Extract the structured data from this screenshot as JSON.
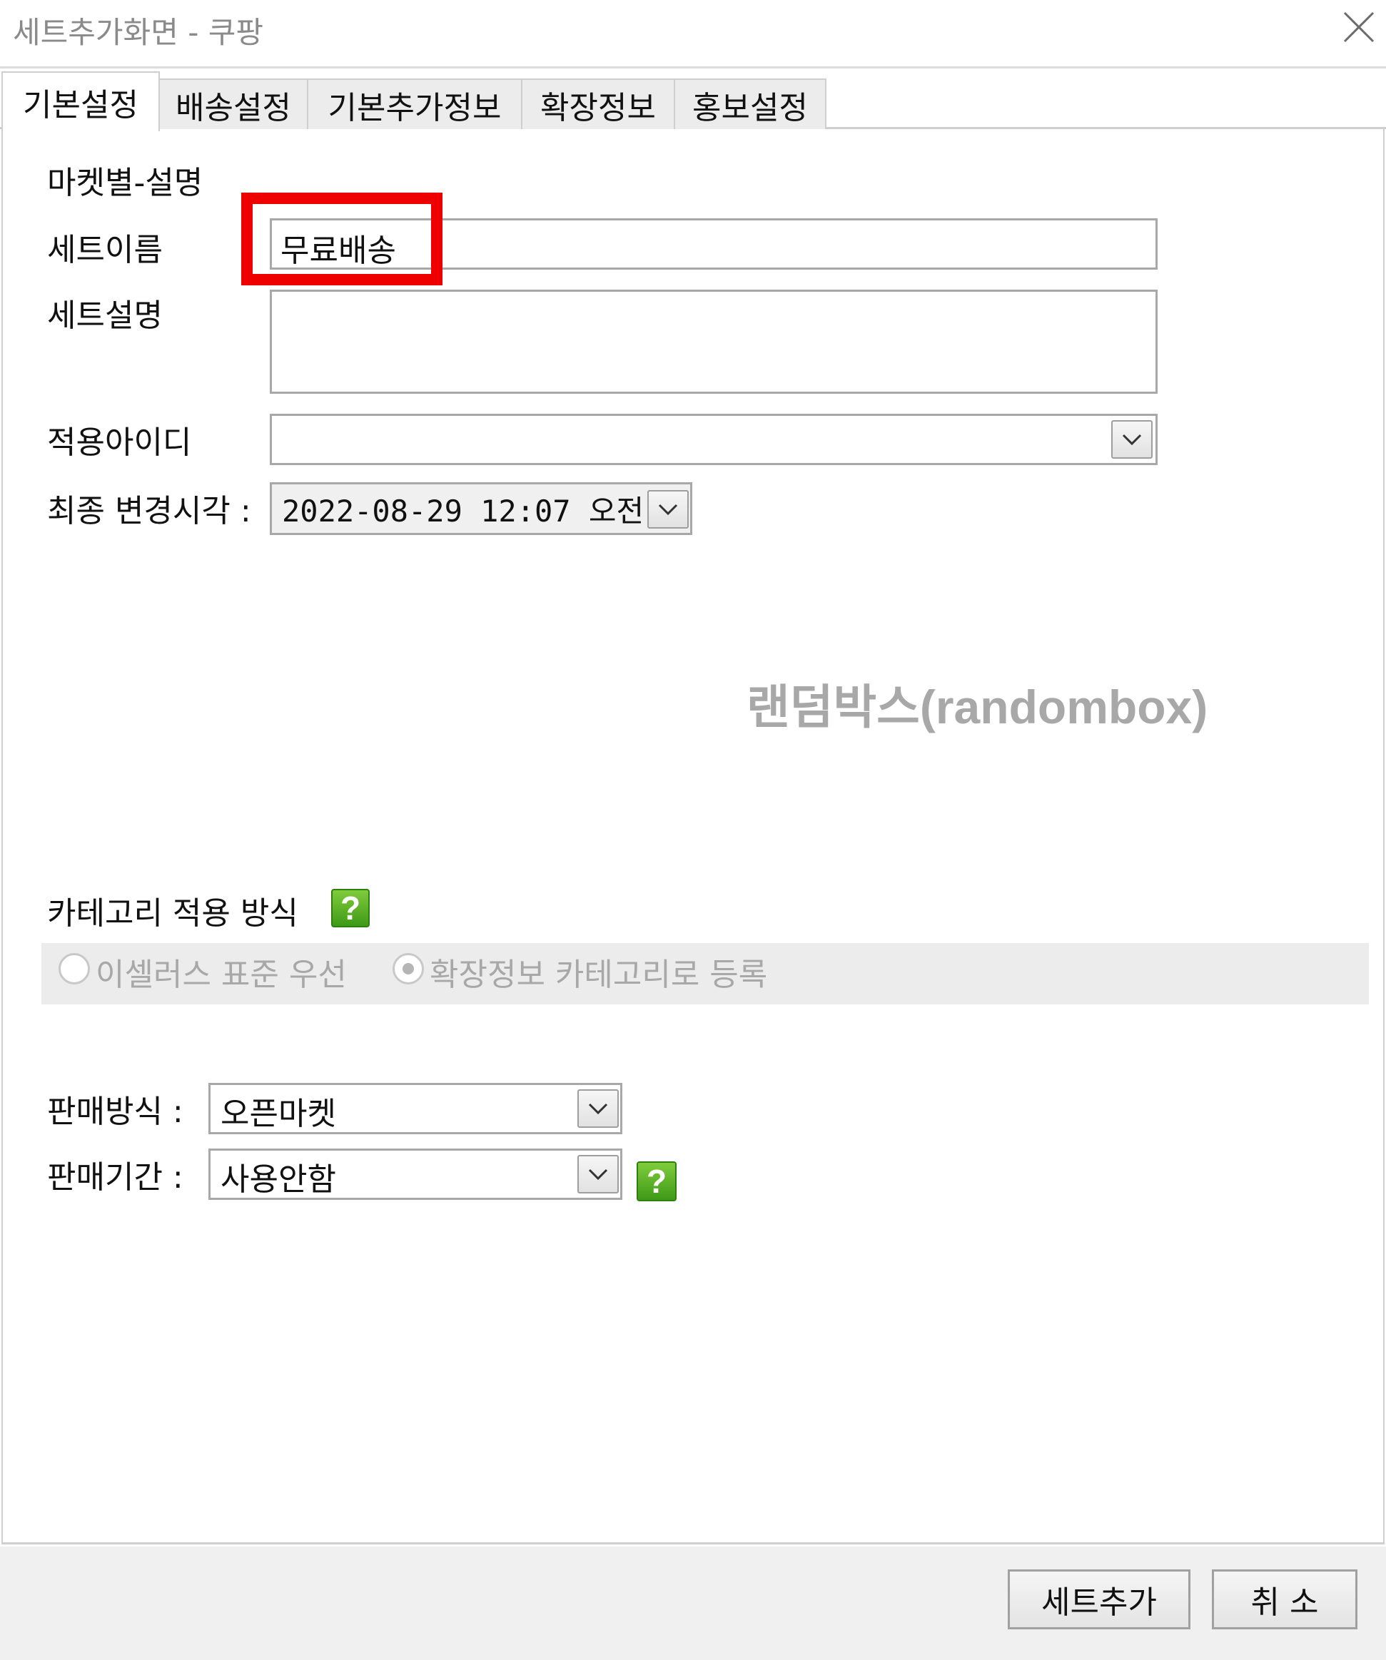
{
  "window": {
    "title": "세트추가화면 - 쿠팡",
    "close_icon": "close-icon"
  },
  "tabs": [
    {
      "label": "기본설정",
      "active": true
    },
    {
      "label": "배송설정",
      "active": false
    },
    {
      "label": "기본추가정보",
      "active": false
    },
    {
      "label": "확장정보",
      "active": false
    },
    {
      "label": "홍보설정",
      "active": false
    }
  ],
  "form": {
    "market_desc_label": "마켓별-설명",
    "set_name": {
      "label": "세트이름",
      "value": "무료배송"
    },
    "set_desc": {
      "label": "세트설명",
      "value": ""
    },
    "apply_id": {
      "label": "적용아이디",
      "value": ""
    },
    "last_modified": {
      "label": "최종 변경시각 :",
      "value": "2022-08-29  12:07 오전"
    }
  },
  "watermark": "랜덤박스(randombox)",
  "category": {
    "label": "카테고리 적용 방식",
    "help_icon": "help-icon",
    "help_text": "?",
    "options": [
      {
        "label": "이셀러스 표준 우선",
        "selected": false,
        "enabled": false
      },
      {
        "label": "확장정보 카테고리로 등록",
        "selected": true,
        "enabled": false
      }
    ]
  },
  "sales": {
    "method": {
      "label": "판매방식 :",
      "value": "오픈마켓"
    },
    "period": {
      "label": "판매기간 :",
      "value": "사용안함",
      "help_text": "?"
    }
  },
  "footer": {
    "add_button": "세트추가",
    "cancel_button": "취 소"
  },
  "colors": {
    "highlight": "#ee0000",
    "help_green": "#4caf1f",
    "panel_gray": "#ececec"
  }
}
